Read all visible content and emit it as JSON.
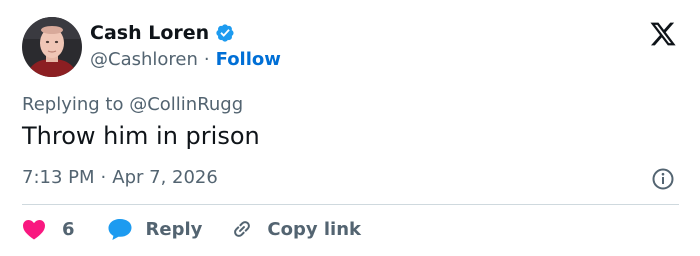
{
  "author": {
    "name": "Cash Loren",
    "handle": "@Cashloren",
    "separator": "·",
    "follow_label": "Follow",
    "verified": true
  },
  "tweet": {
    "replying_to": "Replying to @CollinRugg",
    "text": "Throw him in prison",
    "time": "7:13 PM",
    "separator": "·",
    "date": "Apr 7, 2026"
  },
  "actions": {
    "like_count": "6",
    "reply_label": "Reply",
    "copy_link_label": "Copy link"
  },
  "icons": [
    "verified-badge-icon",
    "x-logo-icon",
    "info-icon",
    "heart-icon",
    "reply-bubble-icon",
    "link-icon"
  ],
  "colors": {
    "accent": "#1d9bf0",
    "follow": "#006fd6",
    "heart": "#f91880",
    "secondary_text": "#536471",
    "primary_text": "#0f1419",
    "divider": "#cfd9de"
  }
}
